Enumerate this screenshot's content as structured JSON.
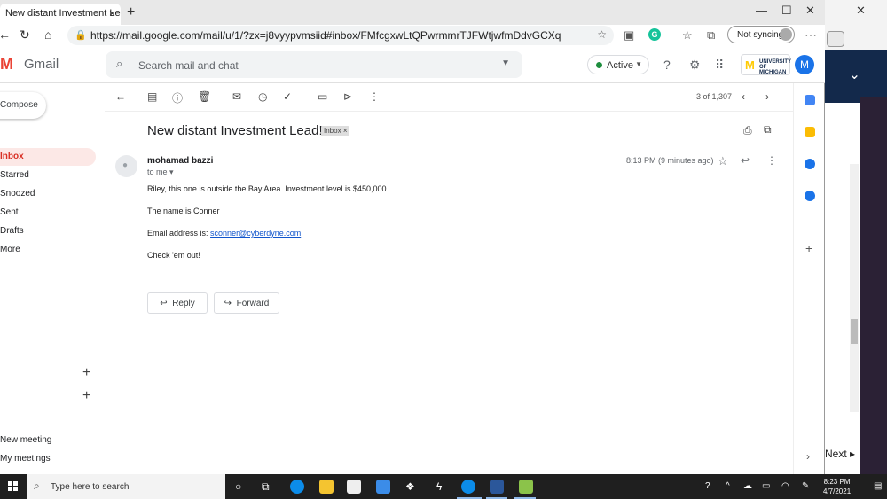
{
  "browser": {
    "tab_title": "New distant Investment Lead! - u",
    "tab_close": "×",
    "new_tab": "+",
    "url": "https://mail.google.com/mail/u/1/?zx=j8vyypvmsiid#inbox/FMfcgxwLtQPwrmmrTJFWtjwfmDdvGCXq",
    "sync_label": "Not syncing"
  },
  "gmail": {
    "logo": "Gmail",
    "search_placeholder": "Search mail and chat",
    "status": "Active",
    "avatar_initial": "M",
    "org": "UNIVERSITY OF MICHIGAN"
  },
  "nav": {
    "compose": "Compose",
    "items": [
      "Inbox",
      "Starred",
      "Snoozed",
      "Sent",
      "Drafts",
      "More"
    ],
    "meet": [
      "New meeting",
      "My meetings"
    ]
  },
  "message": {
    "pager": "3 of 1,307",
    "subject": "New distant Investment Lead!",
    "label": "Inbox",
    "sender": "mohamad bazzi",
    "to": "to me",
    "time": "8:13 PM (9 minutes ago)",
    "body": [
      "Riley, this one is outside the Bay Area. Investment level is $450,000",
      "The name is Conner",
      "Email address is:",
      "Check 'em out!"
    ],
    "email_link": "sconner@cyberdyne.com",
    "reply": "Reply",
    "forward": "Forward"
  },
  "bgwindow": {
    "next": "Next ▸"
  },
  "taskbar": {
    "search_placeholder": "Type here to search",
    "time": "8:23 PM",
    "date": "4/7/2021"
  },
  "colors": {
    "gmail_red": "#ea4335",
    "umich_navy": "#13294b",
    "umich_maize": "#ffcb05",
    "active_green": "#1e8e3e",
    "link_blue": "#1155cc"
  }
}
